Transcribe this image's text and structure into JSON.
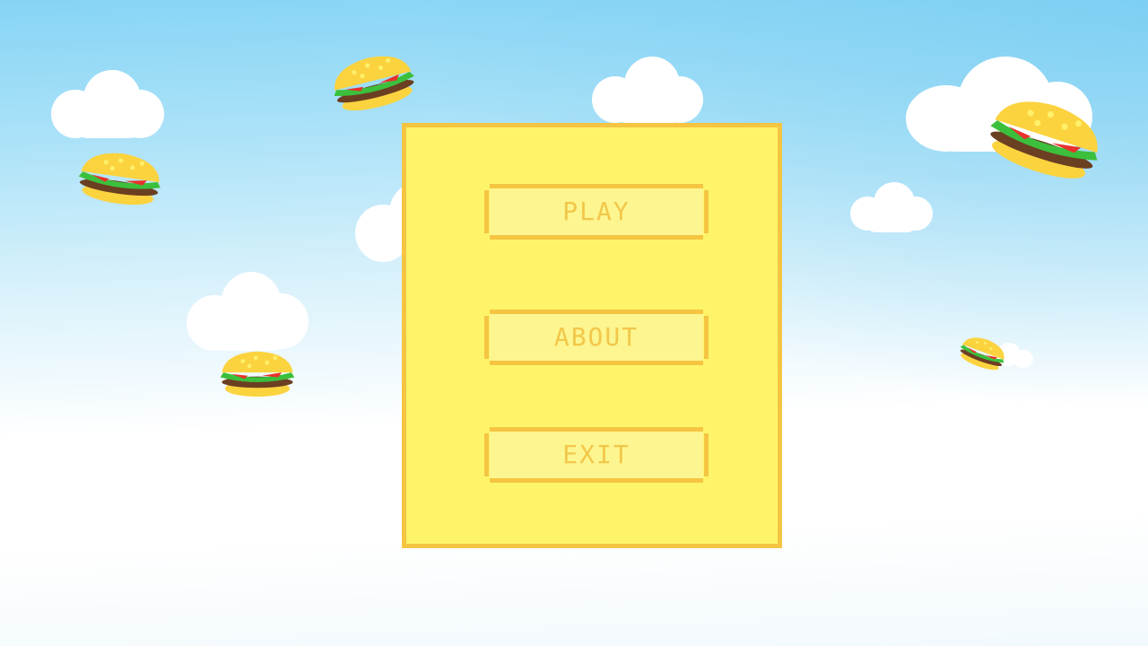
{
  "game": {
    "menu": {
      "buttons": [
        {
          "id": "play",
          "label": "PLAY"
        },
        {
          "id": "about",
          "label": "ABOUT"
        },
        {
          "id": "exit",
          "label": "EXIT"
        }
      ]
    },
    "background": {
      "sky_top": "#86d4f5",
      "sky_bottom": "#ffffff",
      "clouds": "cloud-shapes",
      "falling_objects": "burger-icon"
    }
  },
  "colors": {
    "panel_fill": "#fef46a",
    "panel_border": "#f5c542",
    "button_fill": "#fdf58f",
    "button_text": "#f2c74a",
    "bun": "#fbd33f",
    "patty": "#6b3f22",
    "lettuce": "#3cbf3c",
    "tomato": "#e8312b"
  }
}
